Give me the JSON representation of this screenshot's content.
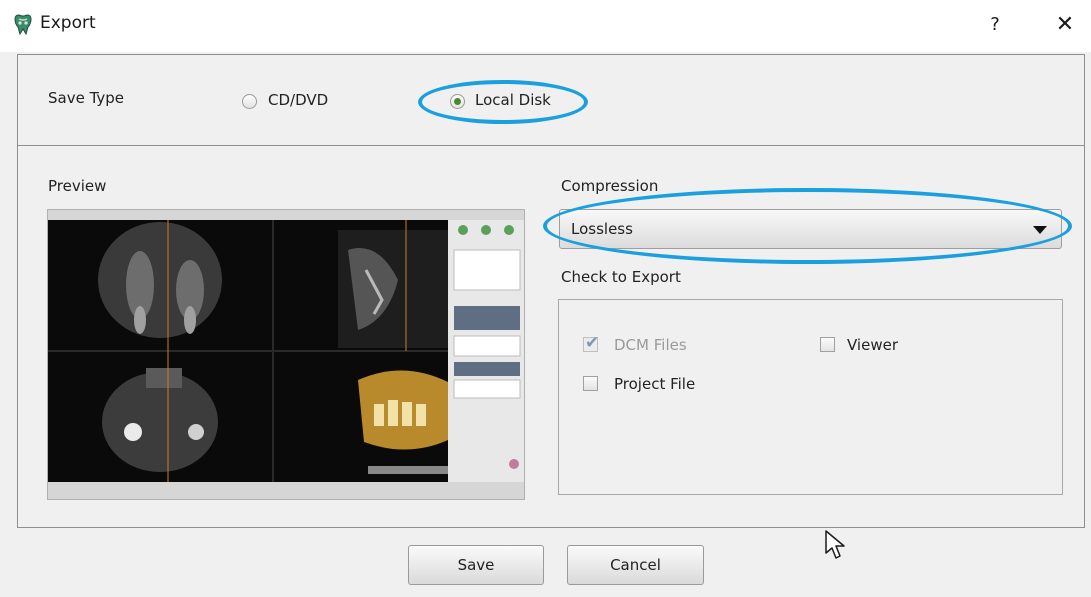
{
  "window": {
    "title": "Export",
    "help_label": "?",
    "close_label": "✕"
  },
  "save_type": {
    "label": "Save Type",
    "options": [
      {
        "label": "CD/DVD",
        "selected": false
      },
      {
        "label": "Local Disk",
        "selected": true
      }
    ]
  },
  "preview": {
    "label": "Preview"
  },
  "compression": {
    "label": "Compression",
    "value": "Lossless"
  },
  "check_to_export": {
    "label": "Check to Export",
    "items": [
      {
        "label": "DCM Files",
        "checked": true,
        "disabled": true
      },
      {
        "label": "Viewer",
        "checked": false,
        "disabled": false
      },
      {
        "label": "Project File",
        "checked": false,
        "disabled": false
      }
    ]
  },
  "buttons": {
    "save_label": "Save",
    "cancel_label": "Cancel"
  },
  "colors": {
    "highlight": "#1aa0de",
    "radio_selected": "#4a8a2e"
  },
  "icons": {
    "app": "tooth-app-icon",
    "cursor": "mouse-pointer-icon"
  }
}
